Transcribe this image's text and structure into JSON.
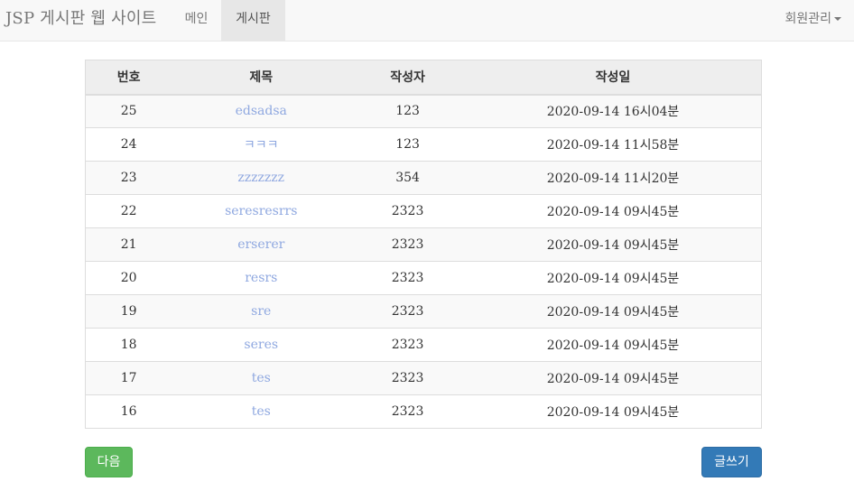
{
  "navbar": {
    "brand": "JSP 게시판 웹 사이트",
    "items": [
      {
        "label": "메인"
      },
      {
        "label": "게시판",
        "active": true
      }
    ],
    "member_menu": "회원관리"
  },
  "table": {
    "headers": [
      "번호",
      "제목",
      "작성자",
      "작성일"
    ],
    "rows": [
      {
        "no": "25",
        "title": "edsadsa",
        "writer": "123",
        "date": "2020-09-14 16시04분"
      },
      {
        "no": "24",
        "title": "ㅋㅋㅋ",
        "writer": "123",
        "date": "2020-09-14 11시58분"
      },
      {
        "no": "23",
        "title": "zzzzzzz",
        "writer": "354",
        "date": "2020-09-14 11시20분"
      },
      {
        "no": "22",
        "title": "seresresrrs",
        "writer": "2323",
        "date": "2020-09-14 09시45분"
      },
      {
        "no": "21",
        "title": "erserer",
        "writer": "2323",
        "date": "2020-09-14 09시45분"
      },
      {
        "no": "20",
        "title": "resrs",
        "writer": "2323",
        "date": "2020-09-14 09시45분"
      },
      {
        "no": "19",
        "title": "sre",
        "writer": "2323",
        "date": "2020-09-14 09시45분"
      },
      {
        "no": "18",
        "title": "seres",
        "writer": "2323",
        "date": "2020-09-14 09시45분"
      },
      {
        "no": "17",
        "title": "tes",
        "writer": "2323",
        "date": "2020-09-14 09시45분"
      },
      {
        "no": "16",
        "title": "tes",
        "writer": "2323",
        "date": "2020-09-14 09시45분"
      }
    ]
  },
  "buttons": {
    "next_label": "다음",
    "write_label": "글쓰기"
  },
  "colors": {
    "next_button": "#5cb85c",
    "write_button": "#337ab7",
    "title_link": "#8fa8e0",
    "navbar_bg": "#f8f8f8"
  }
}
